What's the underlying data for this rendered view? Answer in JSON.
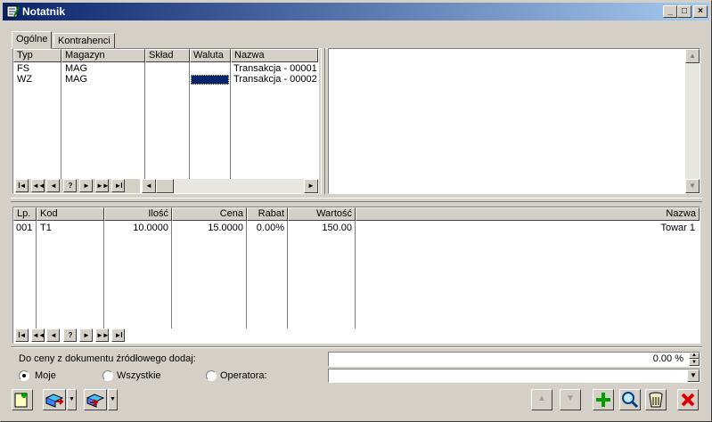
{
  "window": {
    "title": "Notatnik",
    "min": "_",
    "max": "□",
    "close": "×"
  },
  "tabs": [
    {
      "label": "Ogólne",
      "active": true
    },
    {
      "label": "Kontrahenci",
      "active": false
    }
  ],
  "top_grid": {
    "headers": [
      "Typ",
      "Magazyn",
      "Skład",
      "Waluta",
      "Nazwa"
    ],
    "rows": [
      {
        "typ": "FS",
        "magazyn": "MAG",
        "sklad": "",
        "waluta": "",
        "nazwa": "Transakcja - 00001"
      },
      {
        "typ": "WZ",
        "magazyn": "MAG",
        "sklad": "",
        "waluta": "",
        "nazwa": "Transakcja - 00002"
      }
    ]
  },
  "bottom_grid": {
    "headers": [
      "Lp.",
      "Kod",
      "Ilość",
      "Cena",
      "Rabat",
      "Wartość",
      "Nazwa"
    ],
    "rows": [
      {
        "lp": "001",
        "kod": "T1",
        "ilosc": "10.0000",
        "cena": "15.0000",
        "rabat": "0.00%",
        "wartosc": "150.00",
        "nazwa": "Towar 1"
      }
    ]
  },
  "nav": {
    "first": "I◄",
    "prev_page": "◄◄",
    "prev": "◄",
    "find": "?",
    "next": "►",
    "next_page": "►►",
    "last": "►I"
  },
  "bottom": {
    "price_label": "Do ceny z dokumentu źródłowego dodaj:",
    "percent_value": "0.00 %",
    "radio_options": [
      {
        "label": "Moje",
        "selected": true
      },
      {
        "label": "Wszystkie",
        "selected": false
      },
      {
        "label": "Operatora:",
        "selected": false
      }
    ],
    "operator_value": ""
  },
  "colors": {
    "selection": "#0a246a",
    "title_start": "#0a246a",
    "title_end": "#a6caf0"
  }
}
